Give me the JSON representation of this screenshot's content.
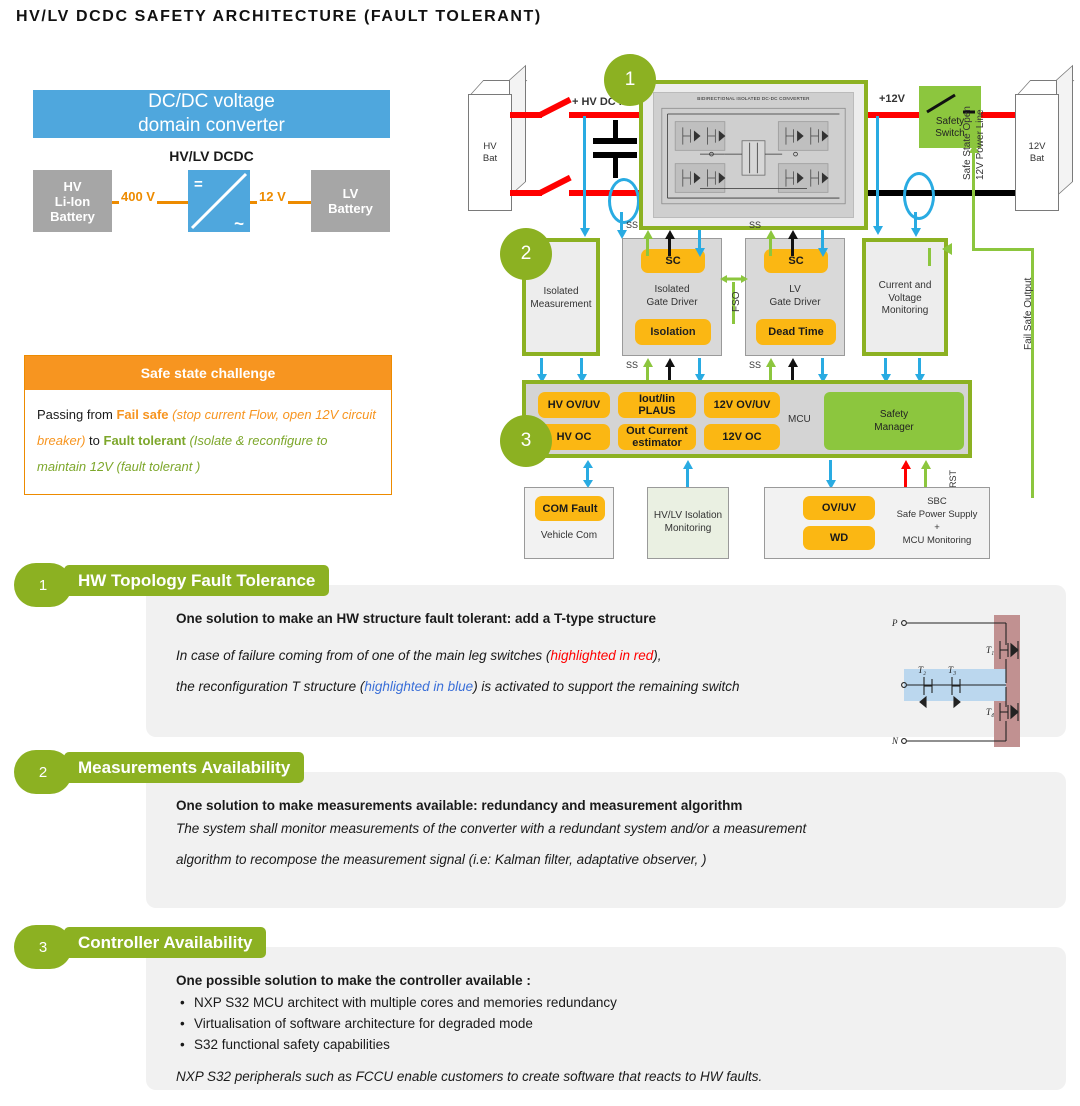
{
  "page_title": "HV/LV DCDC SAFETY ARCHITECTURE (FAULT TOLERANT)",
  "intro": {
    "header_line1": "DC/DC voltage",
    "header_line2": "domain converter",
    "subtitle": "HV/LV DCDC",
    "hv_battery": "HV\nLi-Ion\nBattery",
    "hv_battery_l1": "HV",
    "hv_battery_l2": "Li-Ion",
    "hv_battery_l3": "Battery",
    "lv_battery_l1": "LV",
    "lv_battery_l2": "Battery",
    "voltage_in": "400 V",
    "voltage_out": "12 V",
    "converter_dc_symbol": "=",
    "converter_ac_symbol": "~",
    "header_color": "#4FA7DD",
    "wire_color": "#ED8B00"
  },
  "safe_state": {
    "title": "Safe state challenge",
    "text_part1": "Passing from ",
    "fail_safe_bold": "Fail safe",
    "fail_safe_italic": " (stop current Flow, open 12V circuit breaker)",
    "text_to": " to ",
    "fault_tolerant_bold": "Fault tolerant",
    "fault_tolerant_italic": " (Isolate & reconfigure to maintain 12V (fault tolerant )",
    "header_color": "#F79520",
    "orange": "#F79520",
    "green": "#7DA72B"
  },
  "diagram": {
    "hv_battery_l1": "HV",
    "hv_battery_l2": "Bat",
    "lv_battery_l1": "12V",
    "lv_battery_l2": "Bat",
    "hv_dc_link_label": "+ HV DC li",
    "plus12v_label": "+12V",
    "converter_title": "BIDIRECTIONAL ISOLATED DC-DC CONVERTER",
    "safety_switch_l1": "Safety",
    "safety_switch_l2": "Switch",
    "isolated_measurement_l1": "Isolated",
    "isolated_measurement_l2": "Measurement",
    "isolated_gate_driver_l1": "Isolated",
    "isolated_gate_driver_l2": "Gate Driver",
    "lv_gate_driver_l1": "LV",
    "lv_gate_driver_l2": "Gate Driver",
    "current_voltage_monitoring_l1": "Current and",
    "current_voltage_monitoring_l2": "Voltage",
    "current_voltage_monitoring_l3": "Monitoring",
    "sc_label": "SC",
    "isolation_label": "Isolation",
    "dead_time_label": "Dead Time",
    "ss_label": "SS",
    "fso_label": "FSO",
    "rst_label": "RST",
    "mcu_label": "MCU",
    "safety_manager_l1": "Safety",
    "safety_manager_l2": "Manager",
    "mcu_blocks": [
      "HV OV/UV",
      "Iout/Iin\nPLAUS",
      "12V OV/UV",
      "HV OC",
      "Out Current\nestimator",
      "12V OC"
    ],
    "mcu_block_1": "HV OV/UV",
    "mcu_block_2a": "Iout/Iin",
    "mcu_block_2b": "PLAUS",
    "mcu_block_3": "12V OV/UV",
    "mcu_block_4": "HV OC",
    "mcu_block_5a": "Out Current",
    "mcu_block_5b": "estimator",
    "mcu_block_6": "12V OC",
    "com_fault_pill": "COM Fault",
    "vehicle_com_label": "Vehicle Com",
    "isolation_monitoring_l1": "HV/LV Isolation",
    "isolation_monitoring_l2": "Monitoring",
    "sbc_ovuv_pill": "OV/UV",
    "sbc_wd_pill": "WD",
    "sbc_l1": "SBC",
    "sbc_l2": "Safe Power Supply",
    "sbc_l3": "+",
    "sbc_l4": "MCU Monitoring",
    "vlabel_safe_state_open": "Safe State Open",
    "vlabel_12v_power_line": "12V Power Line",
    "vlabel_fail_safe_output": "Fail Safe Output",
    "callout_1": "1",
    "callout_2": "2",
    "callout_3": "3",
    "green": "#8CB122",
    "green_fill": "#8CC63E",
    "orange_pill": "#FBB713",
    "blue_arrow": "#29ABE2",
    "red": "#FF0000"
  },
  "sections": [
    {
      "number": "1",
      "title": "HW Topology Fault Tolerance",
      "lead": "One solution to make an HW structure fault tolerant: add a T-type structure",
      "body_line1_a": "In case of failure coming from of one of the main leg switches (",
      "body_line1_red": "highlighted in red",
      "body_line1_b": "),",
      "body_line2_a": "the reconfiguration T structure (",
      "body_line2_blue": "highlighted in blue",
      "body_line2_b": ") is activated to support the remaining switch",
      "ttype": {
        "node_p": "P",
        "node_n": "N",
        "t1": "T",
        "t1sub": "1",
        "t2": "T",
        "t2sub": "2",
        "t3": "T",
        "t3sub": "3",
        "t4": "T",
        "t4sub": "4",
        "red_band": "#C19191",
        "blue_band": "#BBD7EE"
      }
    },
    {
      "number": "2",
      "title": "Measurements Availability",
      "lead": "One solution to make measurements available: redundancy and measurement algorithm",
      "body_line1": "The system shall monitor measurements of the converter with a redundant system and/or a measurement",
      "body_line2": "algorithm to recompose the measurement signal (i.e: Kalman filter, adaptative observer, )"
    },
    {
      "number": "3",
      "title": "Controller Availability",
      "lead": "One possible solution to make the controller available :",
      "bullets": [
        "NXP S32 MCU architect with multiple cores and memories redundancy",
        "Virtualisation of software architecture for degraded mode",
        "S32 functional safety capabilities"
      ],
      "closing": "NXP S32 peripherals such as FCCU enable customers to create software that reacts to HW faults."
    }
  ]
}
